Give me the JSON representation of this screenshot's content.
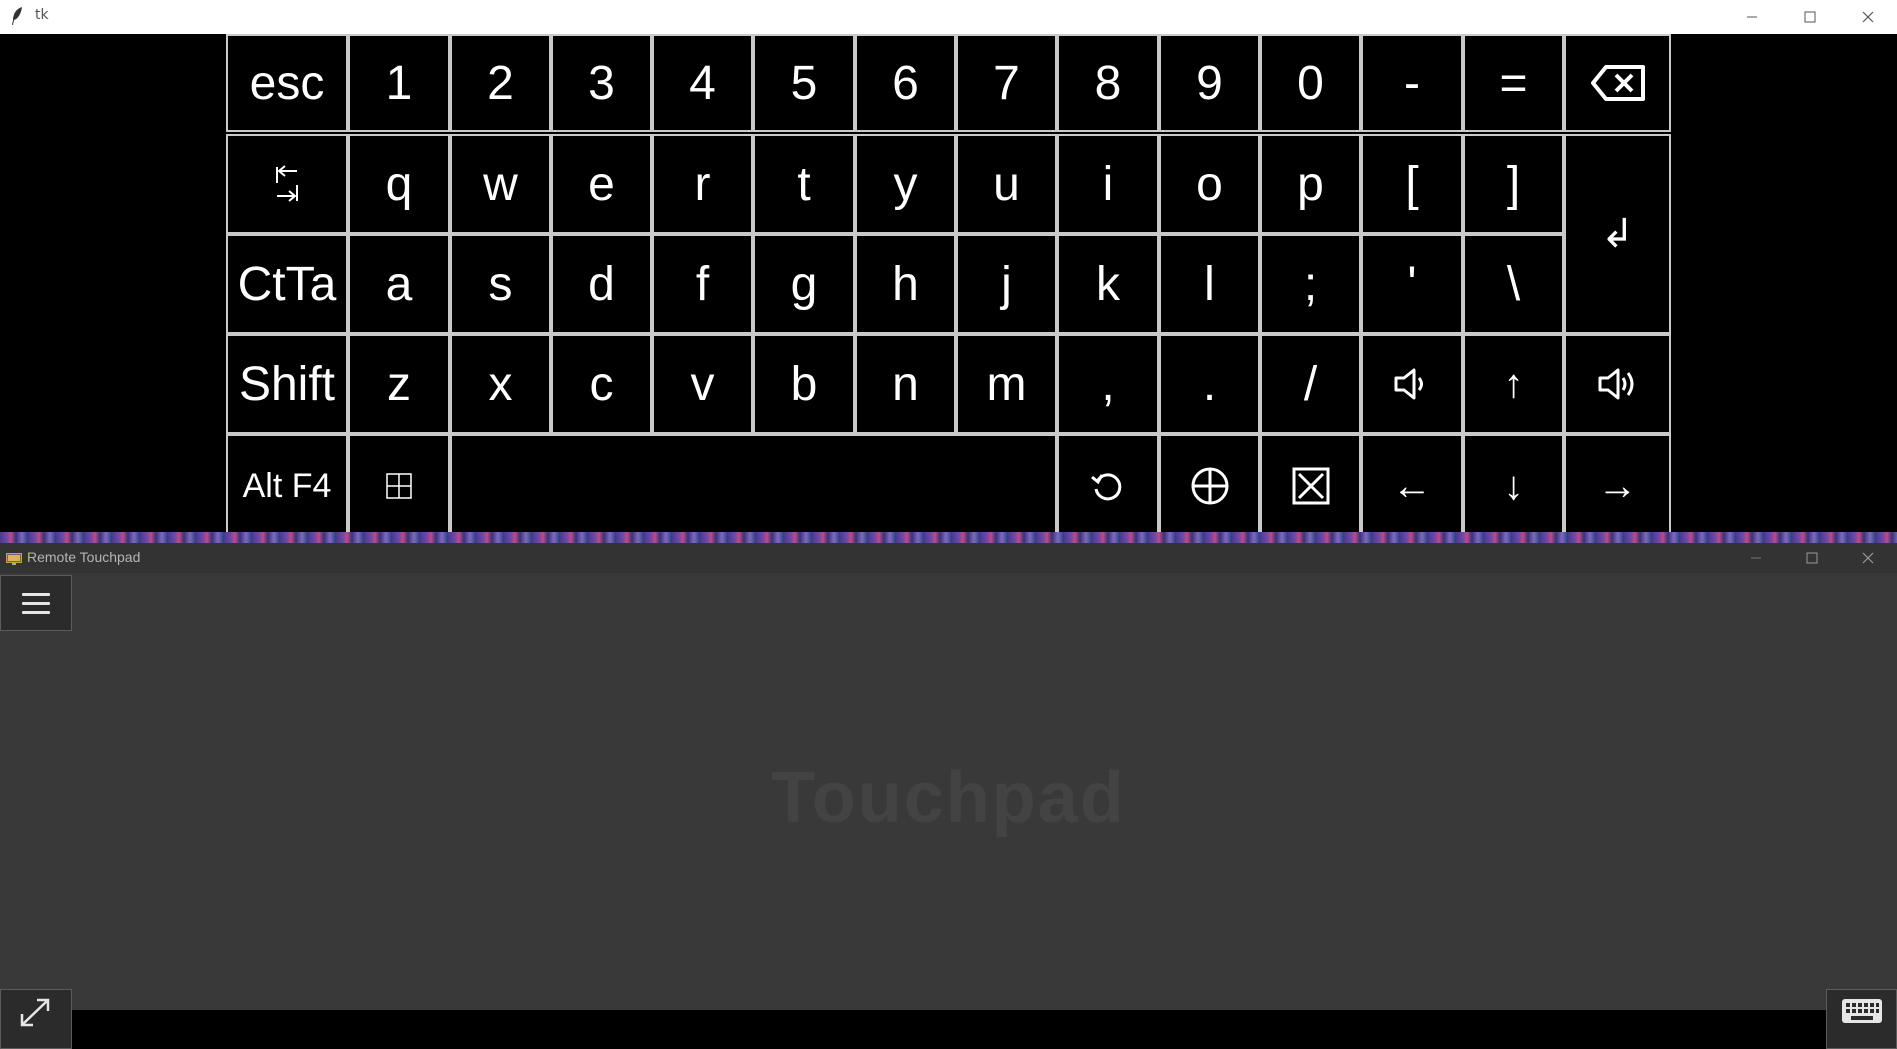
{
  "tk_window": {
    "title": "tk",
    "icon": "feather-icon",
    "controls": [
      "minimize-icon",
      "maximize-icon",
      "close-icon"
    ]
  },
  "keyboard": {
    "row1": [
      "esc",
      "1",
      "2",
      "3",
      "4",
      "5",
      "6",
      "7",
      "8",
      "9",
      "0",
      "-",
      "=",
      "⌫"
    ],
    "row2": [
      "⇥",
      "q",
      "w",
      "e",
      "r",
      "t",
      "y",
      "u",
      "i",
      "o",
      "p",
      "[",
      "]"
    ],
    "enter": "↲",
    "row3": [
      "CtTa",
      "a",
      "s",
      "d",
      "f",
      "g",
      "h",
      "j",
      "k",
      "l",
      ";",
      "'",
      "\\"
    ],
    "row4": [
      "Shift",
      "z",
      "x",
      "c",
      "v",
      "b",
      "n",
      "m",
      ",",
      ".",
      "/",
      "volume-down",
      "↑",
      "volume-up"
    ],
    "row5": [
      "Alt F4",
      "⊞",
      "",
      "⟲",
      "⨁",
      "⊠",
      "←",
      "↓",
      "→"
    ]
  },
  "touchpad_window": {
    "title": "Remote Touchpad",
    "icon": "remote-desktop-icon",
    "controls": [
      "minimize-icon",
      "maximize-icon",
      "close-icon"
    ],
    "pad_label": "Touchpad",
    "menu_icon": "hamburger-menu-icon",
    "fullscreen_icon": "expand-icon",
    "keyboard_icon": "keyboard-icon"
  },
  "colors": {
    "tk_background": "#000000",
    "key_border": "#c9c9c9",
    "key_text": "#ffffff",
    "touchpad_background": "#393939",
    "touchpad_label": "#434343"
  }
}
